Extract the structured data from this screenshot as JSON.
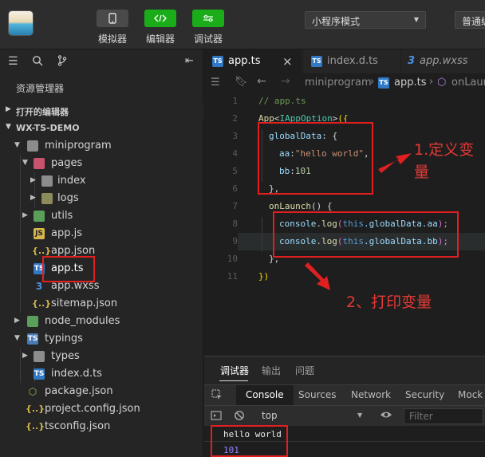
{
  "toolbar": {
    "simulator_label": "模拟器",
    "editor_label": "编辑器",
    "debugger_label": "调试器",
    "mode_select": "小程序模式",
    "compile_label": "普通编译"
  },
  "explorer": {
    "title": "资源管理器",
    "open_editors": "打开的编辑器",
    "project": "WX-TS-DEMO",
    "items": [
      {
        "name": "miniprogram",
        "icon": "folder-open-icon"
      },
      {
        "name": "pages",
        "icon": "folder-icon"
      },
      {
        "name": "index",
        "icon": "folder-icon"
      },
      {
        "name": "logs",
        "icon": "folder-icon"
      },
      {
        "name": "utils",
        "icon": "folder-icon"
      },
      {
        "name": "app.js",
        "icon": "js-file-icon"
      },
      {
        "name": "app.json",
        "icon": "json-file-icon"
      },
      {
        "name": "app.ts",
        "icon": "ts-file-icon"
      },
      {
        "name": "app.wxss",
        "icon": "wxss-file-icon"
      },
      {
        "name": "sitemap.json",
        "icon": "json-file-icon"
      },
      {
        "name": "node_modules",
        "icon": "folder-icon"
      },
      {
        "name": "typings",
        "icon": "folder-icon"
      },
      {
        "name": "types",
        "icon": "folder-icon"
      },
      {
        "name": "index.d.ts",
        "icon": "ts-file-icon"
      },
      {
        "name": "package.json",
        "icon": "package-file-icon"
      },
      {
        "name": "project.config.json",
        "icon": "json-file-icon"
      },
      {
        "name": "tsconfig.json",
        "icon": "json-file-icon"
      }
    ]
  },
  "editor": {
    "tabs": [
      {
        "label": "app.ts",
        "badge": "TS"
      },
      {
        "label": "index.d.ts",
        "badge": "TS"
      },
      {
        "label": "app.wxss",
        "badge": "wxss"
      }
    ],
    "close_glyph": "×",
    "breadcrumb": {
      "folder": "miniprogram",
      "file": "app.ts",
      "symbol": "onLaun"
    },
    "line_numbers": [
      "1",
      "2",
      "3",
      "4",
      "5",
      "6",
      "7",
      "8",
      "9",
      "10",
      "11"
    ],
    "code": {
      "l1": "// app.ts",
      "l2_fn": "App",
      "l2_lt": "<",
      "l2_type": "IAppOption",
      "l2_gt": ">",
      "l2_open": "({",
      "l3_prop": "globalData",
      "l3_rest": ": {",
      "l4_prop": "aa",
      "l4_colon": ":",
      "l4_str": "\"hello world\"",
      "l4_comma": ",",
      "l5_prop": "bb",
      "l5_colon": ":",
      "l5_num": "101",
      "l6": "},",
      "l7_fn": "onLaunch",
      "l7_rest": "() {",
      "l8_obj": "console",
      "l8_dot": ".",
      "l8_fn": "log",
      "l8_open": "(",
      "l8_this": "this",
      "l8_path": ".globalData.aa",
      "l8_close": ");",
      "l9_obj": "console",
      "l9_dot": ".",
      "l9_fn": "log",
      "l9_open": "(",
      "l9_this": "this",
      "l9_path": ".globalData.bb",
      "l9_close": ");",
      "l10": "},",
      "l11": "})"
    }
  },
  "annotations": {
    "note1_line1": "1.定义变",
    "note1_line2": "量",
    "note2": "2、打印变量"
  },
  "panel": {
    "tabs": [
      "调试器",
      "输出",
      "问题"
    ],
    "devtools_tabs": [
      "Console",
      "Sources",
      "Network",
      "Security",
      "Mock"
    ],
    "context": "top",
    "filter_placeholder": "Filter",
    "output": [
      "hello world",
      "101"
    ]
  },
  "colors": {
    "accent_green": "#1aad19",
    "annotation_red": "#e02020",
    "ts_blue": "#3178c6"
  }
}
